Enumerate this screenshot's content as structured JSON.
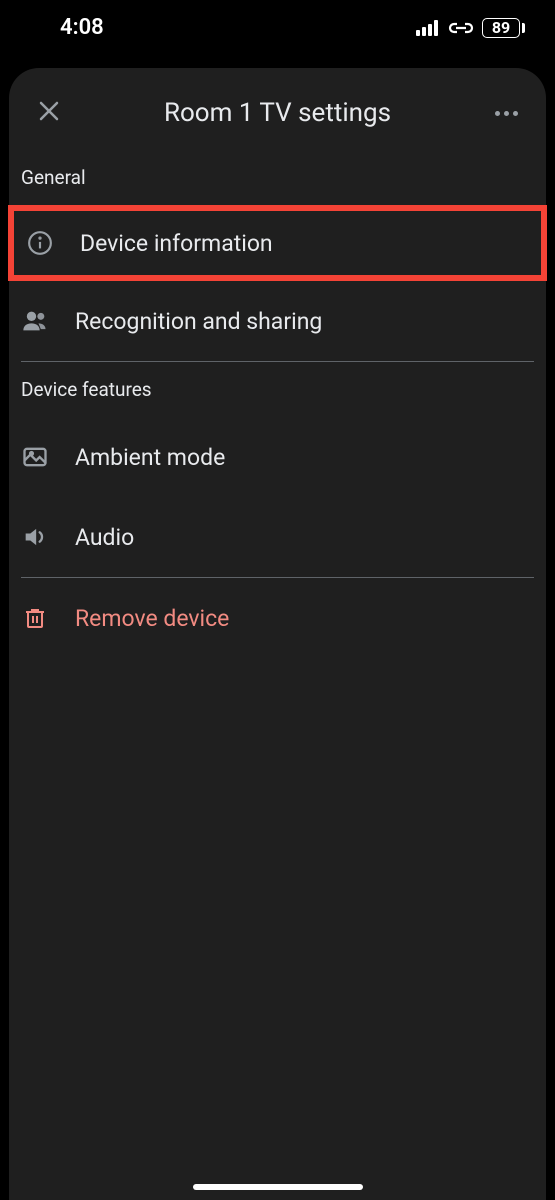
{
  "status": {
    "time": "4:08",
    "battery": "89"
  },
  "header": {
    "title": "Room 1 TV settings"
  },
  "sections": {
    "general": {
      "label": "General",
      "device_info": "Device information",
      "recognition": "Recognition and sharing"
    },
    "features": {
      "label": "Device features",
      "ambient": "Ambient mode",
      "audio": "Audio"
    },
    "remove": "Remove device"
  }
}
